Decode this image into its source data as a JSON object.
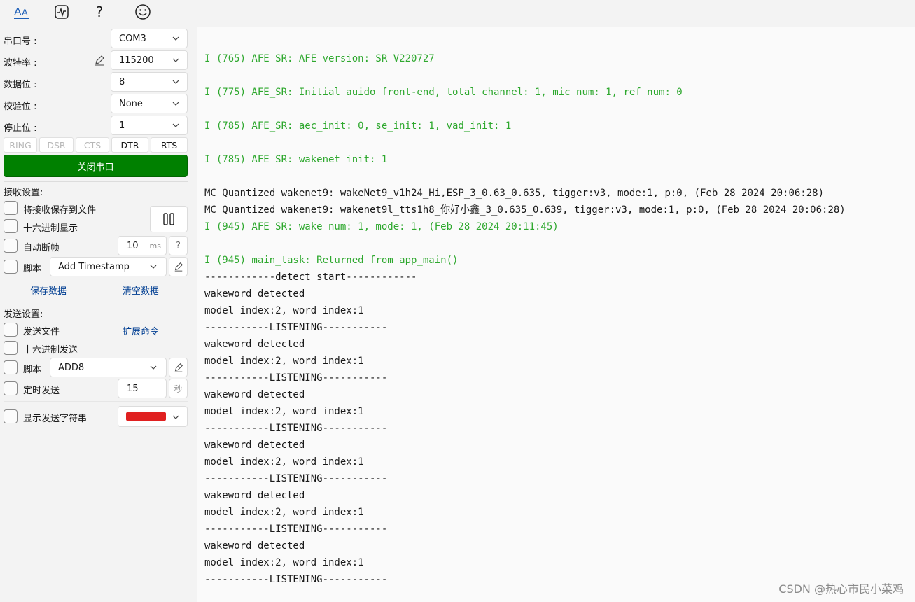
{
  "toolbar": {
    "icons": [
      "font-settings-icon",
      "waveform-icon",
      "help-icon",
      "smiley-icon"
    ],
    "help_glyph": "?"
  },
  "serial": {
    "port_label": "串口号 :",
    "port_value": "COM3",
    "baud_label": "波特率 :",
    "baud_value": "115200",
    "databits_label": "数据位 :",
    "databits_value": "8",
    "parity_label": "校验位 :",
    "parity_value": "None",
    "stopbits_label": "停止位 :",
    "stopbits_value": "1",
    "signals": [
      {
        "label": "RING",
        "active": false
      },
      {
        "label": "DSR",
        "active": false
      },
      {
        "label": "CTS",
        "active": false
      },
      {
        "label": "DTR",
        "active": true
      },
      {
        "label": "RTS",
        "active": true
      }
    ],
    "close_button": "关闭串口"
  },
  "receive": {
    "section_title": "接收设置:",
    "save_to_file": "将接收保存到文件",
    "hex_display": "十六进制显示",
    "pause_glyph": "||",
    "auto_frame": "自动断帧",
    "auto_frame_value": "10",
    "auto_frame_unit": "ms",
    "auto_frame_help": "?",
    "script_label": "脚本",
    "script_value": "Add Timestamp",
    "save_data": "保存数据",
    "clear_data": "清空数据"
  },
  "send": {
    "section_title": "发送设置:",
    "send_file": "发送文件",
    "extend_cmd": "扩展命令",
    "hex_send": "十六进制发送",
    "script_label": "脚本",
    "script_value": "ADD8",
    "timed_send": "定时发送",
    "timed_value": "15",
    "timed_unit": "秒",
    "show_string": "显示发送字符串",
    "color_swatch": "#e02020"
  },
  "console": {
    "lines": [
      {
        "text": "I (765) AFE_SR: AFE version: SR_V220727",
        "color": "green"
      },
      {
        "text": "I (775) AFE_SR: Initial auido front-end, total channel: 1, mic num: 1, ref num: 0",
        "color": "green"
      },
      {
        "text": "I (785) AFE_SR: aec_init: 0, se_init: 1, vad_init: 1",
        "color": "green"
      },
      {
        "text": "I (785) AFE_SR: wakenet_init: 1",
        "color": "green"
      },
      {
        "text": "MC Quantized wakenet9: wakeNet9_v1h24_Hi,ESP_3_0.63_0.635, tigger:v3, mode:1, p:0, (Feb 28 2024 20:06:28)",
        "color": "dark"
      },
      {
        "text": "MC Quantized wakenet9: wakenet9l_tts1h8_你好小鑫_3_0.635_0.639, tigger:v3, mode:1, p:0, (Feb 28 2024 20:06:28)",
        "color": "dark"
      },
      {
        "text": "I (945) AFE_SR: wake num: 1, mode: 1, (Feb 28 2024 20:11:45)",
        "color": "green"
      },
      {
        "text": "I (945) main_task: Returned from app_main()",
        "color": "green"
      },
      {
        "text": "------------detect start------------",
        "color": "dark"
      },
      {
        "text": "wakeword detected",
        "color": "dark"
      },
      {
        "text": "model index:2, word index:1",
        "color": "dark"
      },
      {
        "text": "-----------LISTENING-----------",
        "color": "dark"
      },
      {
        "text": "wakeword detected",
        "color": "dark"
      },
      {
        "text": "model index:2, word index:1",
        "color": "dark"
      },
      {
        "text": "-----------LISTENING-----------",
        "color": "dark"
      },
      {
        "text": "wakeword detected",
        "color": "dark"
      },
      {
        "text": "model index:2, word index:1",
        "color": "dark"
      },
      {
        "text": "-----------LISTENING-----------",
        "color": "dark"
      },
      {
        "text": "wakeword detected",
        "color": "dark"
      },
      {
        "text": "model index:2, word index:1",
        "color": "dark"
      },
      {
        "text": "-----------LISTENING-----------",
        "color": "dark"
      },
      {
        "text": "wakeword detected",
        "color": "dark"
      },
      {
        "text": "model index:2, word index:1",
        "color": "dark"
      },
      {
        "text": "-----------LISTENING-----------",
        "color": "dark"
      },
      {
        "text": "wakeword detected",
        "color": "dark"
      },
      {
        "text": "model index:2, word index:1",
        "color": "dark"
      },
      {
        "text": "-----------LISTENING-----------",
        "color": "dark"
      }
    ]
  },
  "watermark": "CSDN @热心市民小菜鸡"
}
